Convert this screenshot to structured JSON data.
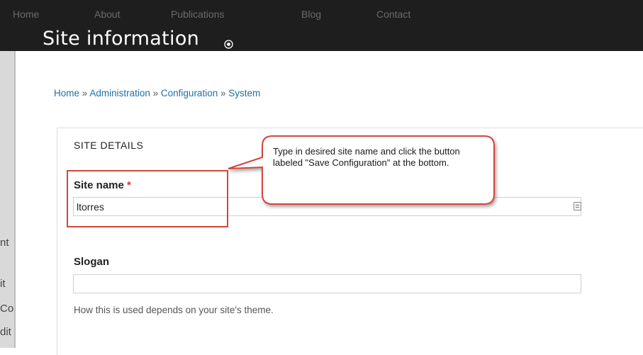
{
  "nav": {
    "items": [
      {
        "label": "Home"
      },
      {
        "label": "About"
      },
      {
        "label": "Publications"
      },
      {
        "label": "Blog"
      },
      {
        "label": "Contact"
      }
    ]
  },
  "page": {
    "title": "Site information",
    "title_icon": "plus-circle-icon"
  },
  "left_fragments": [
    "nt",
    "it",
    "Co",
    "dit"
  ],
  "breadcrumb": {
    "items": [
      "Home",
      "Administration",
      "Configuration",
      "System"
    ],
    "separator": "»"
  },
  "form": {
    "fieldset_legend": "SITE DETAILS",
    "site_name": {
      "label": "Site name",
      "required_marker": "*",
      "value": "ltorres",
      "input_icon": "autofill-icon"
    },
    "slogan": {
      "label": "Slogan",
      "value": "",
      "description": "How this is used depends on your site's theme."
    }
  },
  "annotation": {
    "callout_text": "Type in desired site name and click the button labeled \"Save Configuration\" at the bottom.",
    "highlight_color": "#d6453b"
  },
  "colors": {
    "top_bar": "#1e1e1e",
    "link": "#1f6fa8",
    "required": "#d9352f"
  }
}
